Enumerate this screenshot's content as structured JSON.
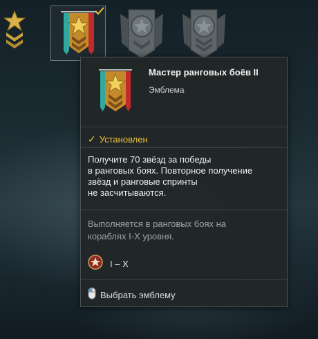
{
  "tooltip": {
    "title": "Мастер ранговых боёв II",
    "subtitle": "Эмблема",
    "status": "Установлен",
    "description": [
      "Получите 70 звёзд за победы",
      "в ранговых боях. Повторное получение",
      "звёзд и ранговые спринты",
      "не засчитываются."
    ],
    "conditions": [
      "Выполняется в ранговых боях на",
      "кораблях I-X уровня."
    ],
    "tier_range": "I – X",
    "action_label": "Выбрать эмблему"
  },
  "colors": {
    "accent_gold": "#f2c23a",
    "panel_bg": "#212628",
    "muted_text": "#9aa3a5"
  },
  "icons": [
    "gold-badge-icon",
    "ranked-emblem-icon",
    "checkmark-icon",
    "grey-emblem-icon",
    "ranked-battle-icon",
    "mouse-icon"
  ]
}
